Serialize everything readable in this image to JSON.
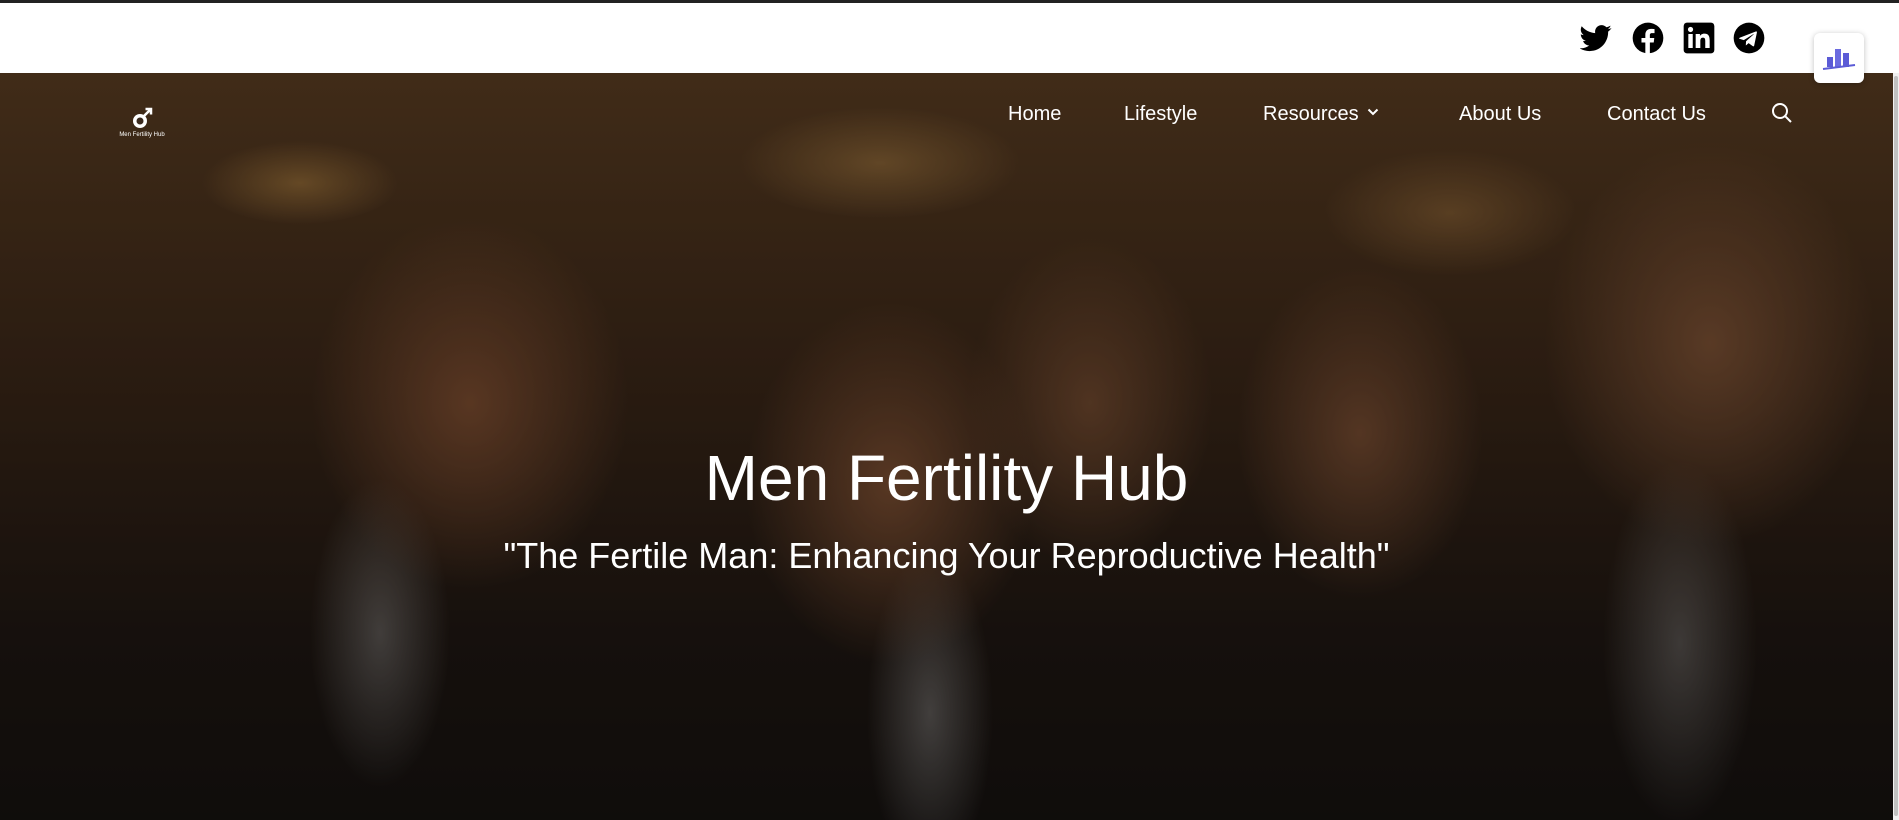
{
  "social": [
    {
      "icon": "twitter-icon"
    },
    {
      "icon": "facebook-icon"
    },
    {
      "icon": "linkedin-icon"
    },
    {
      "icon": "telegram-icon"
    }
  ],
  "widget": {
    "icon": "chart-widget-icon"
  },
  "logo": {
    "text": "Men Fertility Hub"
  },
  "nav": {
    "home": "Home",
    "lifestyle": "Lifestyle",
    "resources": "Resources",
    "about": "About Us",
    "contact": "Contact Us"
  },
  "hero": {
    "title": "Men Fertility Hub",
    "subtitle": "\"The Fertile Man: Enhancing Your Reproductive Health\""
  },
  "colors": {
    "text_light": "#ffffff",
    "icon_dark": "#000000",
    "widget_accent": "#5b5bd6"
  }
}
